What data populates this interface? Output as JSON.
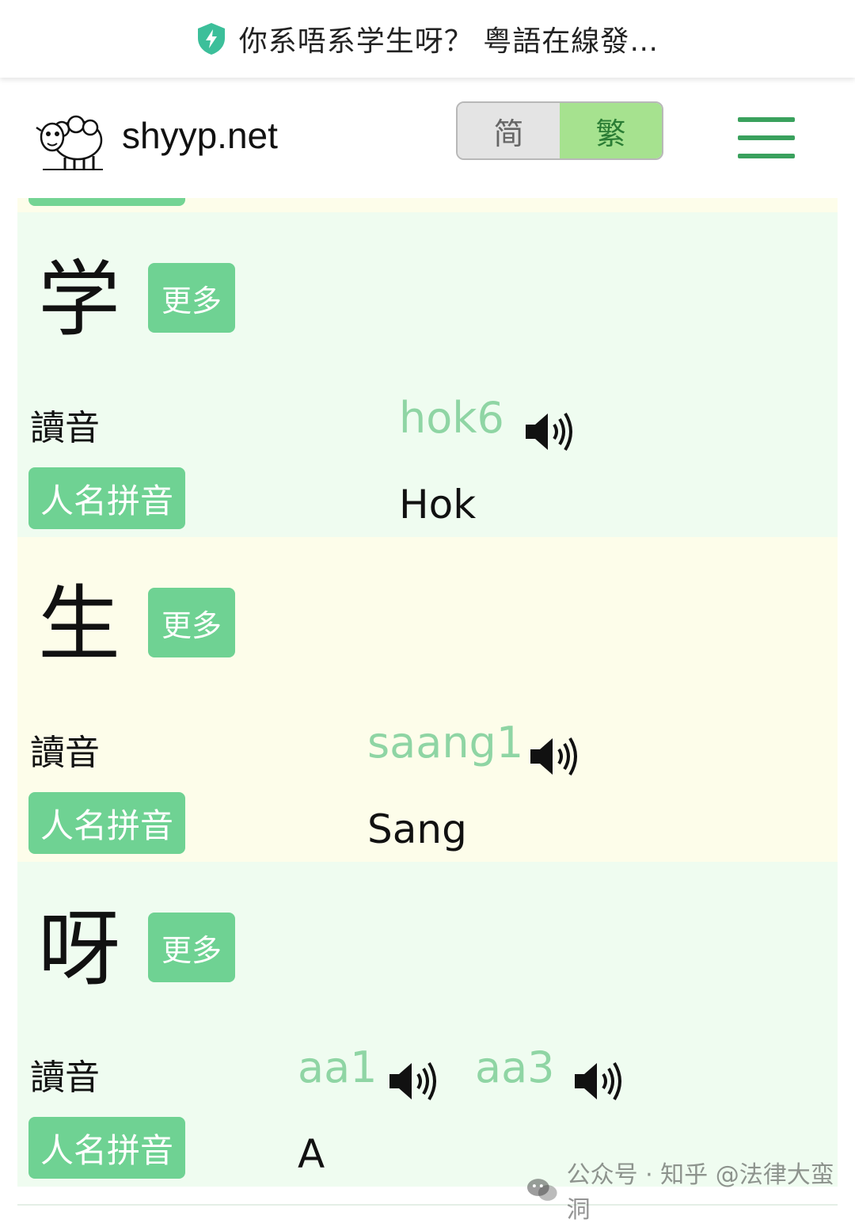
{
  "topbar": {
    "title": "你系唔系学生呀？ 粤語在線發…"
  },
  "header": {
    "site_name": "shyyp.net",
    "toggle": {
      "simplified": "简",
      "traditional": "繁",
      "selected": "traditional"
    }
  },
  "labels": {
    "more": "更多",
    "reading": "讀音",
    "name_romanization": "人名拼音"
  },
  "entries": [
    {
      "char": "学",
      "readings": [
        "hok6"
      ],
      "romanization": "Hok"
    },
    {
      "char": "生",
      "readings": [
        "saang1"
      ],
      "romanization": "Sang"
    },
    {
      "char": "呀",
      "readings": [
        "aa1",
        "aa3"
      ],
      "romanization": "A"
    }
  ],
  "watermark": {
    "text": "公众号 · 知乎 @法律大蛮洞"
  },
  "colors": {
    "accent_green": "#6fd293",
    "pron_green": "#8fd5a4",
    "menu_green": "#3aa15d",
    "card_green": "#effcf0",
    "card_cream": "#fdfdea"
  }
}
